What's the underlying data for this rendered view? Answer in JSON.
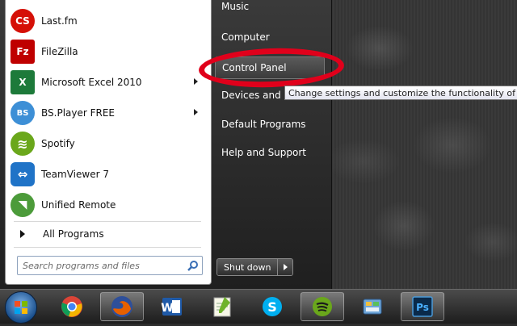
{
  "programs": [
    {
      "label": "Last.fm",
      "icon": "lastfm-icon",
      "glyph": "CS",
      "color": "#d51007",
      "has_submenu": false
    },
    {
      "label": "FileZilla",
      "icon": "filezilla-icon",
      "glyph": "Fz",
      "color": "#bf0000",
      "has_submenu": false
    },
    {
      "label": "Microsoft Excel 2010",
      "icon": "excel-icon",
      "glyph": "X",
      "color": "#1d7a3a",
      "has_submenu": true
    },
    {
      "label": "BS.Player FREE",
      "icon": "bsplayer-icon",
      "glyph": "BS",
      "color": "#3d8fd6",
      "has_submenu": true
    },
    {
      "label": "Spotify",
      "icon": "spotify-icon",
      "glyph": "≋",
      "color": "#6aa71b",
      "has_submenu": false
    },
    {
      "label": "TeamViewer 7",
      "icon": "teamviewer-icon",
      "glyph": "⇔",
      "color": "#1f73c7",
      "has_submenu": false
    },
    {
      "label": "Unified Remote",
      "icon": "unified-remote-icon",
      "glyph": "◥",
      "color": "#4c9b3a",
      "has_submenu": false
    }
  ],
  "all_programs_label": "All Programs",
  "search": {
    "placeholder": "Search programs and files"
  },
  "right_items": [
    {
      "label": "Music",
      "highlighted": false
    },
    {
      "label": "Computer",
      "highlighted": false
    },
    {
      "label": "Control Panel",
      "highlighted": true
    },
    {
      "label": "Devices and Pr",
      "highlighted": false
    },
    {
      "label": "Default Programs",
      "highlighted": false
    },
    {
      "label": "Help and Support",
      "highlighted": false
    }
  ],
  "tooltip": "Change settings and customize the functionality of yo",
  "shutdown_label": "Shut down",
  "taskbar": [
    {
      "name": "chrome-icon",
      "active": false
    },
    {
      "name": "firefox-icon",
      "active": true
    },
    {
      "name": "word-icon",
      "active": false
    },
    {
      "name": "notepad-plus-icon",
      "active": false
    },
    {
      "name": "skype-icon",
      "active": false
    },
    {
      "name": "spotify-icon",
      "active": true
    },
    {
      "name": "control-panel-icon",
      "active": false
    },
    {
      "name": "photoshop-icon",
      "active": true
    }
  ],
  "colors": {
    "annotation": "#e0001b",
    "hover": "#4a4a4a"
  }
}
